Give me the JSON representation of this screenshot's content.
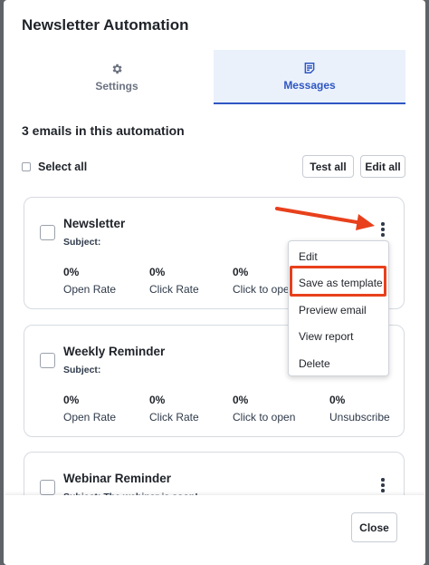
{
  "modal": {
    "title": "Newsletter Automation"
  },
  "tabs": [
    {
      "label": "Settings",
      "icon": "gear-icon"
    },
    {
      "label": "Messages",
      "icon": "document-icon"
    }
  ],
  "summary": {
    "count_text": "3 emails in this automation"
  },
  "toolbar": {
    "select_all_label": "Select all",
    "test_all_label": "Test all",
    "edit_all_label": "Edit all"
  },
  "cards": [
    {
      "name": "Newsletter",
      "subject": "Subject:",
      "stats": [
        {
          "value": "0%",
          "label": "Open Rate"
        },
        {
          "value": "0%",
          "label": "Click Rate"
        },
        {
          "value": "0%",
          "label": "Click to ope"
        }
      ]
    },
    {
      "name": "Weekly Reminder",
      "subject": "Subject:",
      "stats": [
        {
          "value": "0%",
          "label": "Open Rate"
        },
        {
          "value": "0%",
          "label": "Click Rate"
        },
        {
          "value": "0%",
          "label": "Click to open"
        },
        {
          "value": "0%",
          "label": "Unsubscribe"
        }
      ]
    },
    {
      "name": "Webinar Reminder",
      "subject": "Subject: The webinar is soon!"
    }
  ],
  "menu": {
    "items": [
      "Edit",
      "Save as template",
      "Preview email",
      "View report",
      "Delete"
    ],
    "highlighted": "Save as template"
  },
  "footer": {
    "close_label": "Close"
  },
  "colors": {
    "accent": "#2f56c3",
    "annotation": "#e8401c",
    "tab_active_bg": "#eaf1fb"
  }
}
